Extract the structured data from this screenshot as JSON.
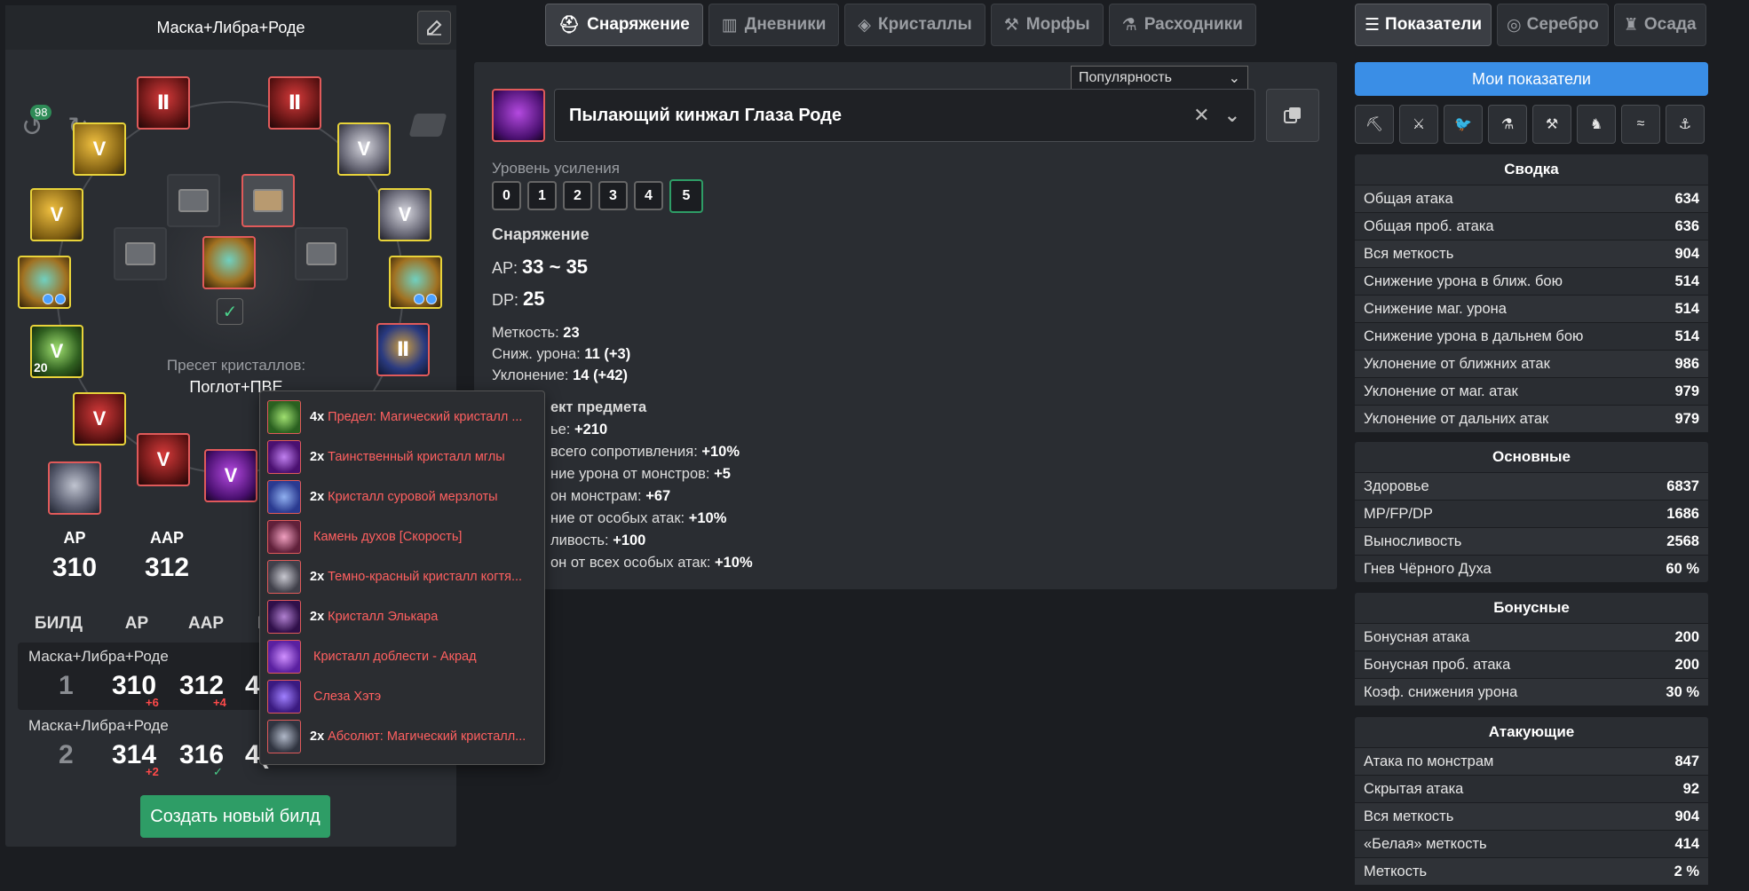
{
  "left": {
    "title": "Маска+Либра+Роде",
    "history_count": "98",
    "preset_label": "Пресет кристаллов:",
    "preset_value": "Поглот+ПВЕ",
    "slot_20": "20",
    "stats": [
      {
        "label": "AP",
        "value": "310"
      },
      {
        "label": "AAP",
        "value": "312"
      }
    ],
    "build_headers": [
      "БИЛД",
      "AP",
      "AAP",
      "D"
    ],
    "builds": [
      {
        "name": "Маска+Либра+Роде",
        "index": "1",
        "ap": "310",
        "ap_diff": "+6",
        "aap": "312",
        "aap_diff": "+4",
        "extra": "4"
      },
      {
        "name": "Маска+Либра+Роде",
        "index": "2",
        "ap": "314",
        "ap_diff": "+2",
        "aap": "316",
        "aap_diff": "✓",
        "extra": "4("
      }
    ],
    "create_button": "Создать новый билд"
  },
  "popup": [
    {
      "count": "4x",
      "name": "Предел: Магический кристалл ...",
      "color": "#5ab04a"
    },
    {
      "count": "2x",
      "name": "Таинственный кристалл мглы",
      "color": "#8a40c0"
    },
    {
      "count": "2x",
      "name": "Кристалл суровой мерзлоты",
      "color": "#4a6ad0"
    },
    {
      "count": "",
      "name": "Камень духов [Скорость]",
      "color": "#d05a8a"
    },
    {
      "count": "2x",
      "name": "Темно-красный кристалл когтя...",
      "color": "#6a6a78"
    },
    {
      "count": "2x",
      "name": "Кристалл Элькара",
      "color": "#7a3aa0"
    },
    {
      "count": "",
      "name": "Кристалл доблести - Акрад",
      "color": "#a04ae0"
    },
    {
      "count": "",
      "name": "Слеза Хэтэ",
      "color": "#6a40c0"
    },
    {
      "count": "2x",
      "name": "Абсолют: Магический кристалл...",
      "color": "#4a4e58"
    }
  ],
  "tabs": [
    "Снаряжение",
    "Дневники",
    "Кристаллы",
    "Морфы",
    "Расходники"
  ],
  "center": {
    "sort": "Популярность",
    "item_name": "Пылающий кинжал Глаза Роде",
    "level_label": "Уровень усиления",
    "levels": [
      "0",
      "1",
      "2",
      "3",
      "4",
      "5"
    ],
    "section_title": "Снаряжение",
    "ap_label": "AP:",
    "ap_value": "33 ~ 35",
    "dp_label": "DP:",
    "dp_value": "25",
    "stats": [
      {
        "label": "Меткость:",
        "value": "23",
        "bonus": ""
      },
      {
        "label": "Сниж. урона:",
        "value": "11",
        "bonus": "(+3)"
      },
      {
        "label": "Уклонение:",
        "value": "14",
        "bonus": "(+42)"
      }
    ],
    "effect_title": "ект предмета",
    "effects": [
      {
        "label": "ье:",
        "value": "+210"
      },
      {
        "label": "всего сопротивления:",
        "value": "+10%"
      },
      {
        "label": "ние урона от монстров:",
        "value": "+5"
      },
      {
        "label": "он монстрам:",
        "value": "+67"
      },
      {
        "label": "ние от особых атак:",
        "value": "+10%"
      },
      {
        "label": "ливость:",
        "value": "+100"
      },
      {
        "label": "он от всех особых атак:",
        "value": "+10%"
      }
    ]
  },
  "right_tabs": [
    "Показатели",
    "Серебро",
    "Осада"
  ],
  "my_stats": "Мои показатели",
  "sections": [
    {
      "title": "Сводка",
      "rows": [
        {
          "label": "Общая атака",
          "value": "634"
        },
        {
          "label": "Общая проб. атака",
          "value": "636"
        },
        {
          "label": "Вся меткость",
          "value": "904"
        },
        {
          "label": "Снижение урона в ближ. бою",
          "value": "514"
        },
        {
          "label": "Снижение маг. урона",
          "value": "514"
        },
        {
          "label": "Снижение урона в дальнем бою",
          "value": "514"
        },
        {
          "label": "Уклонение от ближних атак",
          "value": "986"
        },
        {
          "label": "Уклонение от маг. атак",
          "value": "979"
        },
        {
          "label": "Уклонение от дальних атак",
          "value": "979"
        }
      ]
    },
    {
      "title": "Основные",
      "rows": [
        {
          "label": "Здоровье",
          "value": "6837"
        },
        {
          "label": "MP/FP/DP",
          "value": "1686"
        },
        {
          "label": "Выносливость",
          "value": "2568"
        },
        {
          "label": "Гнев Чёрного Духа",
          "value": "60 %"
        }
      ]
    },
    {
      "title": "Бонусные",
      "rows": [
        {
          "label": "Бонусная атака",
          "value": "200"
        },
        {
          "label": "Бонусная проб. атака",
          "value": "200"
        },
        {
          "label": "Коэф. снижения урона",
          "value": "30 %"
        }
      ]
    },
    {
      "title": "Атакующие",
      "rows": [
        {
          "label": "Атака по монстрам",
          "value": "847"
        },
        {
          "label": "Скрытая атака",
          "value": "92"
        },
        {
          "label": "Вся меткость",
          "value": "904"
        },
        {
          "label": "«Белая» меткость",
          "value": "414"
        },
        {
          "label": "Меткость",
          "value": "2 %"
        }
      ]
    }
  ]
}
